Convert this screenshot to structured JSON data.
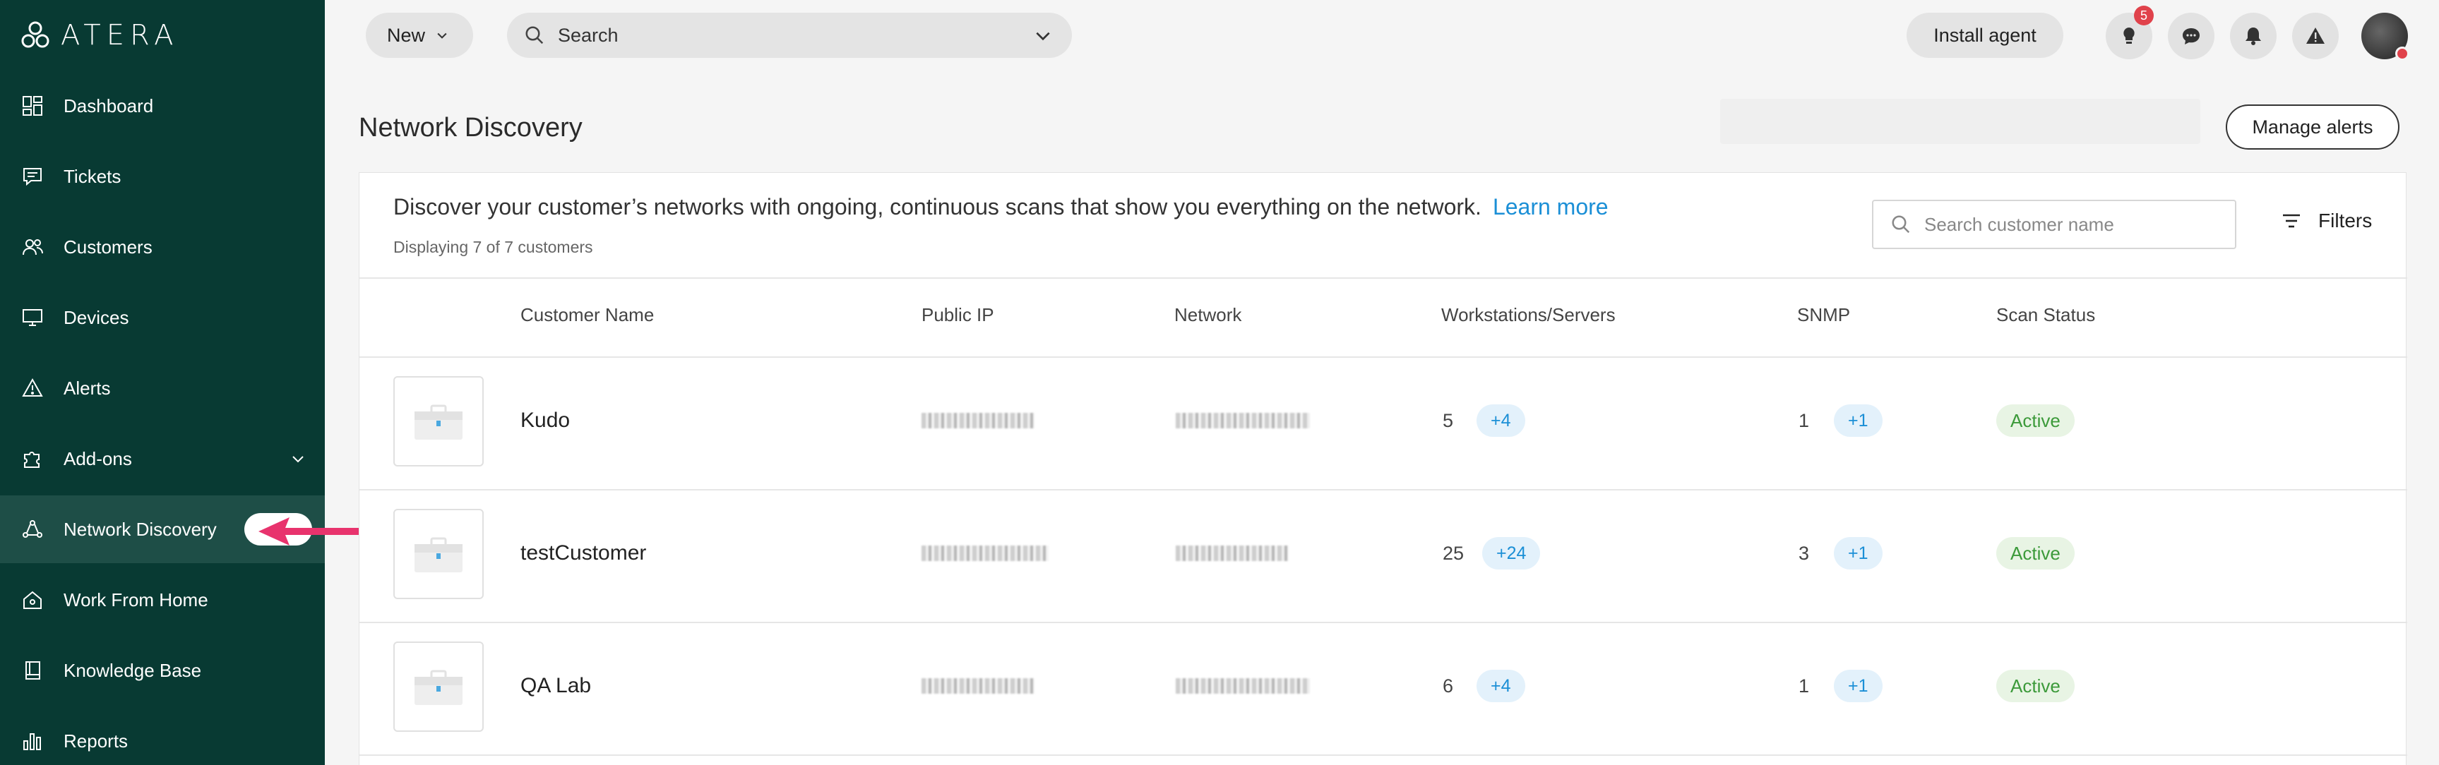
{
  "app": {
    "logo_text": "ATERA"
  },
  "sidebar": {
    "items": [
      {
        "label": "Dashboard",
        "icon": "dashboard-icon"
      },
      {
        "label": "Tickets",
        "icon": "ticket-icon"
      },
      {
        "label": "Customers",
        "icon": "customers-icon"
      },
      {
        "label": "Devices",
        "icon": "monitor-icon"
      },
      {
        "label": "Alerts",
        "icon": "alert-triangle-icon"
      },
      {
        "label": "Add-ons",
        "icon": "puzzle-icon"
      },
      {
        "label": "Network Discovery",
        "icon": "network-icon"
      },
      {
        "label": "Work From Home",
        "icon": "home-icon"
      },
      {
        "label": "Knowledge Base",
        "icon": "book-icon"
      },
      {
        "label": "Reports",
        "icon": "bar-chart-icon"
      }
    ],
    "active": "Network Discovery"
  },
  "topbar": {
    "new_label": "New",
    "search_label": "Search",
    "install_label": "Install agent",
    "notification_count": "5"
  },
  "page": {
    "title": "Network Discovery",
    "manage_alerts_label": "Manage alerts",
    "description": "Discover your customer’s networks with ongoing, continuous scans that show you everything on the network.",
    "learn_more": "Learn more",
    "displaying": "Displaying 7 of 7 customers",
    "search_placeholder": "Search customer name",
    "filters_label": "Filters"
  },
  "table": {
    "headers": [
      "Customer Name",
      "Public IP",
      "Network",
      "Workstations/Servers",
      "SNMP",
      "Scan Status"
    ],
    "rows": [
      {
        "name": "Kudo",
        "workstations": "5",
        "workstations_extra": "+4",
        "snmp": "1",
        "snmp_extra": "+1",
        "status": "Active",
        "warning": true
      },
      {
        "name": "testCustomer",
        "workstations": "25",
        "workstations_extra": "+24",
        "snmp": "3",
        "snmp_extra": "+1",
        "status": "Active",
        "warning": false
      },
      {
        "name": "QA Lab",
        "workstations": "6",
        "workstations_extra": "+4",
        "snmp": "1",
        "snmp_extra": "+1",
        "status": "Active",
        "warning": true
      }
    ]
  },
  "colors": {
    "sidebar_bg": "#083a33",
    "sidebar_active": "#1e4e47",
    "link_blue": "#1b8fd6",
    "status_green": "#3c9a3a",
    "warning_orange": "#f0a020",
    "arrow_pink": "#e8336d"
  }
}
